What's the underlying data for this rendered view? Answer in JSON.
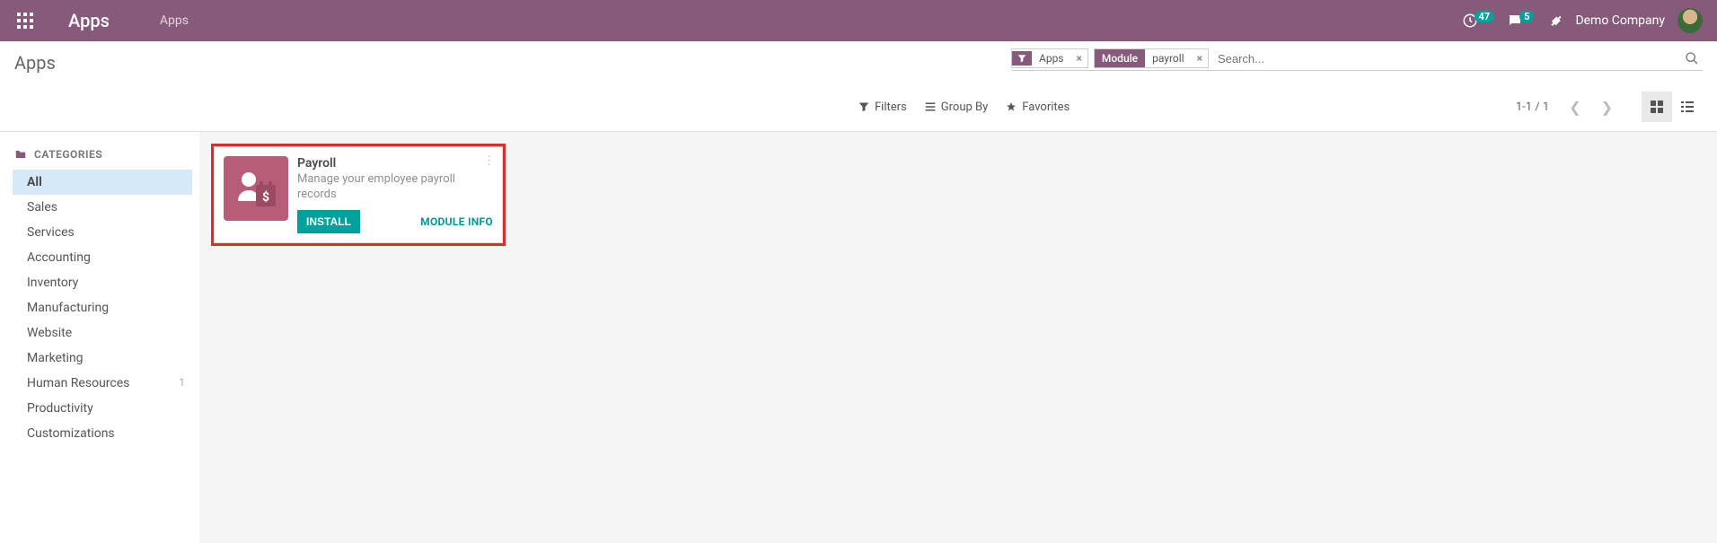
{
  "topbar": {
    "brand": "Apps",
    "breadcrumb": "Apps",
    "activity_count": "47",
    "message_count": "5",
    "company": "Demo Company"
  },
  "control_panel": {
    "title": "Apps",
    "filter_tags": [
      {
        "type": "icon",
        "value": "Apps"
      },
      {
        "type": "label",
        "label": "Module",
        "value": "payroll"
      }
    ],
    "search_placeholder": "Search...",
    "filters_label": "Filters",
    "groupby_label": "Group By",
    "favorites_label": "Favorites",
    "pager": "1-1 / 1"
  },
  "sidebar": {
    "header": "CATEGORIES",
    "items": [
      {
        "label": "All",
        "active": true
      },
      {
        "label": "Sales"
      },
      {
        "label": "Services"
      },
      {
        "label": "Accounting"
      },
      {
        "label": "Inventory"
      },
      {
        "label": "Manufacturing"
      },
      {
        "label": "Website"
      },
      {
        "label": "Marketing"
      },
      {
        "label": "Human Resources",
        "count": "1"
      },
      {
        "label": "Productivity"
      },
      {
        "label": "Customizations"
      }
    ]
  },
  "app_card": {
    "title": "Payroll",
    "description": "Manage your employee payroll records",
    "install_label": "INSTALL",
    "module_info_label": "MODULE INFO"
  }
}
